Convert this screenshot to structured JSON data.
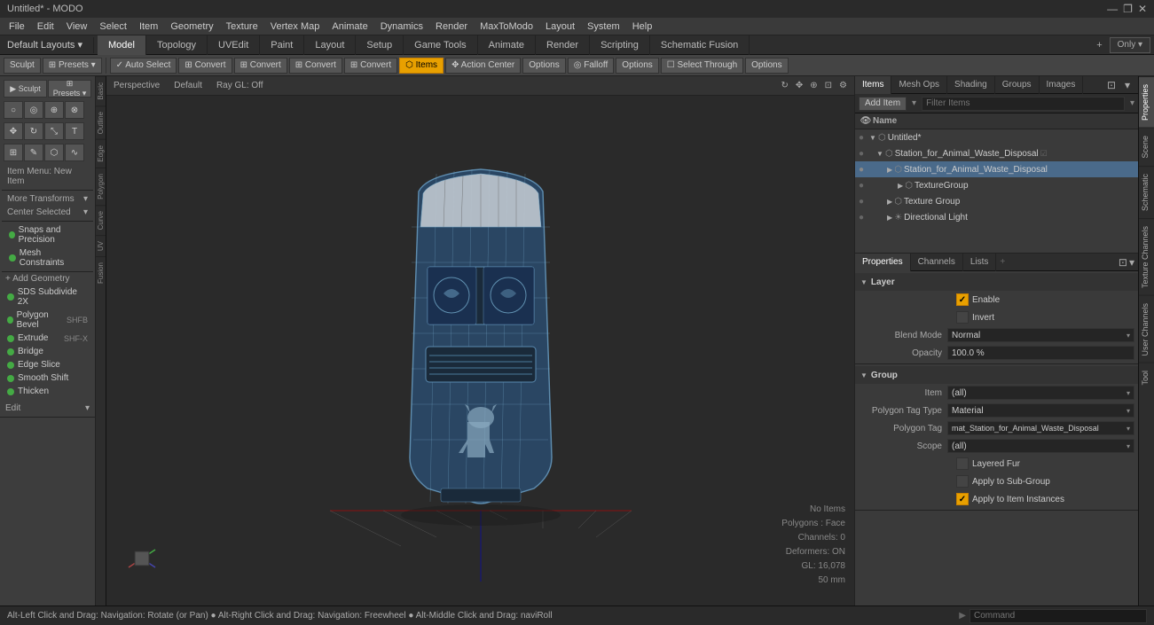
{
  "titlebar": {
    "title": "Untitled* - MODO",
    "minimize": "—",
    "maximize": "❐",
    "close": "✕"
  },
  "menubar": {
    "items": [
      "File",
      "Edit",
      "View",
      "Select",
      "Item",
      "Geometry",
      "Texture",
      "Vertex Map",
      "Animate",
      "Dynamics",
      "Render",
      "MaxToModo",
      "Layout",
      "System",
      "Help"
    ]
  },
  "layout_bar": {
    "preset": "Default Layouts ▾",
    "tabs": [
      "Model",
      "Topology",
      "UVEdit",
      "Paint",
      "Layout",
      "Setup",
      "Game Tools",
      "Animate",
      "Render",
      "Scripting",
      "Schematic Fusion"
    ],
    "active_tab": "Model",
    "add_icon": "+",
    "only_label": "Only ▾"
  },
  "toolbar": {
    "sculpt": "Sculpt",
    "presets": "⊞ Presets ▾",
    "auto_select": "Auto Select",
    "convert1": "Convert",
    "convert2": "Convert",
    "convert3": "Convert",
    "convert4": "Convert",
    "items": "Items",
    "action_center": "Action Center",
    "options1": "Options",
    "falloff": "Falloff",
    "options2": "Options",
    "select_through": "Select Through",
    "options3": "Options"
  },
  "viewport": {
    "projection": "Perspective",
    "shading": "Default",
    "gl_info": "Ray GL: Off"
  },
  "left_sidebar": {
    "basic_label": "Basic",
    "outline_label": "Outline",
    "edge_label": "Edge",
    "polygon_label": "Polygon",
    "curve_label": "Curve",
    "uv_label": "UV",
    "fusion_label": "Fusion",
    "item_menu": "Item Menu: New Item",
    "more_transforms": "More Transforms",
    "center_selected": "Center Selected",
    "add_geometry": "+ Add Geometry",
    "tools": [
      {
        "label": "SDS Subdivide 2X",
        "shortcut": ""
      },
      {
        "label": "Polygon Bevel",
        "shortcut": "SHFB"
      },
      {
        "label": "Extrude",
        "shortcut": "SHF-X"
      },
      {
        "label": "Bridge",
        "shortcut": ""
      },
      {
        "label": "Edge Slice",
        "shortcut": ""
      },
      {
        "label": "Smooth Shift",
        "shortcut": ""
      },
      {
        "label": "Thicken",
        "shortcut": ""
      }
    ],
    "edit_label": "Edit"
  },
  "right_panel": {
    "tabs": [
      "Items",
      "Mesh Ops",
      "Shading",
      "Groups",
      "Images"
    ],
    "active_tab": "Items",
    "add_item": "Add Item",
    "filter_placeholder": "Filter Items",
    "name_column": "Name",
    "tree": [
      {
        "level": 0,
        "name": "Untitled*",
        "type": "scene",
        "expanded": true
      },
      {
        "level": 1,
        "name": "Station_for_Animal_Waste_Disposal",
        "type": "mesh",
        "expanded": true,
        "has_eye": true
      },
      {
        "level": 2,
        "name": "Station_for_Animal_Waste_Disposal",
        "type": "mesh",
        "expanded": false,
        "has_eye": true
      },
      {
        "level": 3,
        "name": "TextureGroup",
        "type": "group",
        "expanded": false
      },
      {
        "level": 2,
        "name": "Texture Group",
        "type": "group",
        "expanded": false
      },
      {
        "level": 2,
        "name": "Directional Light",
        "type": "light",
        "expanded": false
      }
    ]
  },
  "properties": {
    "tabs": [
      "Properties",
      "Channels",
      "Lists"
    ],
    "active_tab": "Properties",
    "sections": {
      "layer": {
        "label": "Layer",
        "enable_label": "Enable",
        "enable_checked": true,
        "invert_label": "Invert",
        "invert_checked": false,
        "blend_mode_label": "Blend Mode",
        "blend_mode_value": "Normal",
        "opacity_label": "Opacity",
        "opacity_value": "100.0 %"
      },
      "group": {
        "label": "Group",
        "item_label": "Item",
        "item_value": "(all)",
        "poly_tag_type_label": "Polygon Tag Type",
        "poly_tag_type_value": "Material",
        "poly_tag_label": "Polygon Tag",
        "poly_tag_value": "mat_Station_for_Animal_Waste_Disposal",
        "scope_label": "Scope",
        "scope_value": "(all)",
        "layered_fur_label": "Layered Fur",
        "layered_fur_checked": false,
        "apply_sub_label": "Apply to Sub-Group",
        "apply_sub_checked": false,
        "apply_instances_label": "Apply to Item Instances",
        "apply_instances_checked": true
      }
    }
  },
  "side_tabs": [
    "Basic",
    "Outline",
    "Edge",
    "Polygon",
    "Curve",
    "UV",
    "Fusion"
  ],
  "right_side_tabs": [
    "Properties",
    "Scene",
    "Schematic",
    "Texture Channels",
    "User Channels",
    "Tool"
  ],
  "statusbar": {
    "hint": "Alt-Left Click and Drag: Navigation: Rotate (or Pan) ● Alt-Right Click and Drag: Navigation: Freewheel ● Alt-Middle Click and Drag: naviRoll",
    "command_placeholder": "Command",
    "no_items": "No Items",
    "polygons": "Polygons : Face",
    "channels": "Channels: 0",
    "deformers": "Deformers: ON",
    "gl": "GL: 16,078",
    "mm": "50 mm"
  }
}
